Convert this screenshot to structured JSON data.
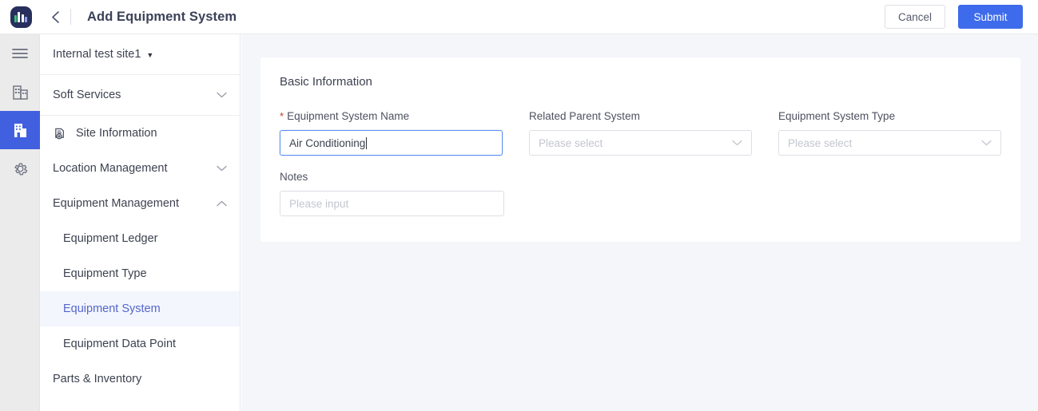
{
  "header": {
    "logo_icon": "brand-logo-icon",
    "back_icon": "chevron-left-icon",
    "title": "Add Equipment System",
    "cancel_label": "Cancel",
    "submit_label": "Submit",
    "submit_color": "#3d6beb"
  },
  "rail": {
    "items": [
      {
        "icon": "hamburger-menu-icon",
        "active": false
      },
      {
        "icon": "building-outline-icon",
        "active": false
      },
      {
        "icon": "building-filled-icon",
        "active": true
      },
      {
        "icon": "gear-icon",
        "active": false
      }
    ],
    "active_color": "#4060e0"
  },
  "sidebar": {
    "site_selector": {
      "label": "Internal test site1",
      "caret_icon": "caret-down-icon"
    },
    "groups": [
      {
        "label": "Soft Services",
        "chevron": "chevron-down-icon",
        "expanded": false
      }
    ],
    "items": [
      {
        "label": "Site Information",
        "icon": "site-information-icon",
        "type": "item",
        "active": false
      },
      {
        "label": "Location Management",
        "chevron": "chevron-down-icon",
        "type": "group",
        "active": false
      },
      {
        "label": "Equipment Management",
        "chevron": "chevron-up-icon",
        "type": "group",
        "active": false
      },
      {
        "label": "Equipment Ledger",
        "type": "sub",
        "active": false
      },
      {
        "label": "Equipment Type",
        "type": "sub",
        "active": false
      },
      {
        "label": "Equipment System",
        "type": "sub",
        "active": true
      },
      {
        "label": "Equipment Data Point",
        "type": "sub",
        "active": false
      },
      {
        "label": "Parts & Inventory",
        "type": "item",
        "active": false
      }
    ],
    "active_bg": "#f3f6fd",
    "active_color": "#5566cc"
  },
  "form": {
    "section_title": "Basic Information",
    "fields": {
      "equipment_system_name": {
        "label": "Equipment System Name",
        "required_marker": "*",
        "value": "Air Conditioning",
        "focused": true
      },
      "related_parent_system": {
        "label": "Related Parent System",
        "placeholder": "Please select",
        "chevron": "chevron-down-icon"
      },
      "equipment_system_type": {
        "label": "Equipment System Type",
        "placeholder": "Please select",
        "chevron": "chevron-down-icon"
      },
      "notes": {
        "label": "Notes",
        "placeholder": "Please input"
      }
    }
  }
}
